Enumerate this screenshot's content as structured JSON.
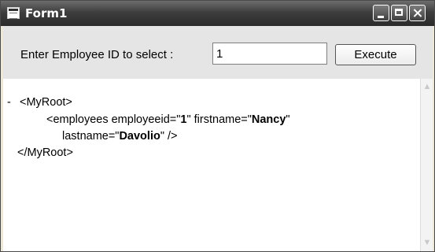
{
  "window": {
    "title": "Form1"
  },
  "form": {
    "prompt_label": "Enter Employee ID to select :",
    "employee_id_value": "1",
    "execute_label": "Execute"
  },
  "xml": {
    "collapse_glyph": "-",
    "root_open": "<MyRoot>",
    "element_open": "<employees employeeid=\"",
    "employeeid_value": "1",
    "firstname_attr": "\" firstname=\"",
    "firstname_value": "Nancy",
    "quote_close": "\"",
    "lastname_attr": "lastname=\"",
    "lastname_value": "Davolio",
    "element_close": "\" />",
    "root_close": "</MyRoot>"
  },
  "icons": {
    "app": "form-icon",
    "minimize": "minimize-icon",
    "maximize": "maximize-icon",
    "close": "close-icon",
    "scroll_up": "chevron-up-icon",
    "scroll_down": "chevron-down-icon"
  }
}
